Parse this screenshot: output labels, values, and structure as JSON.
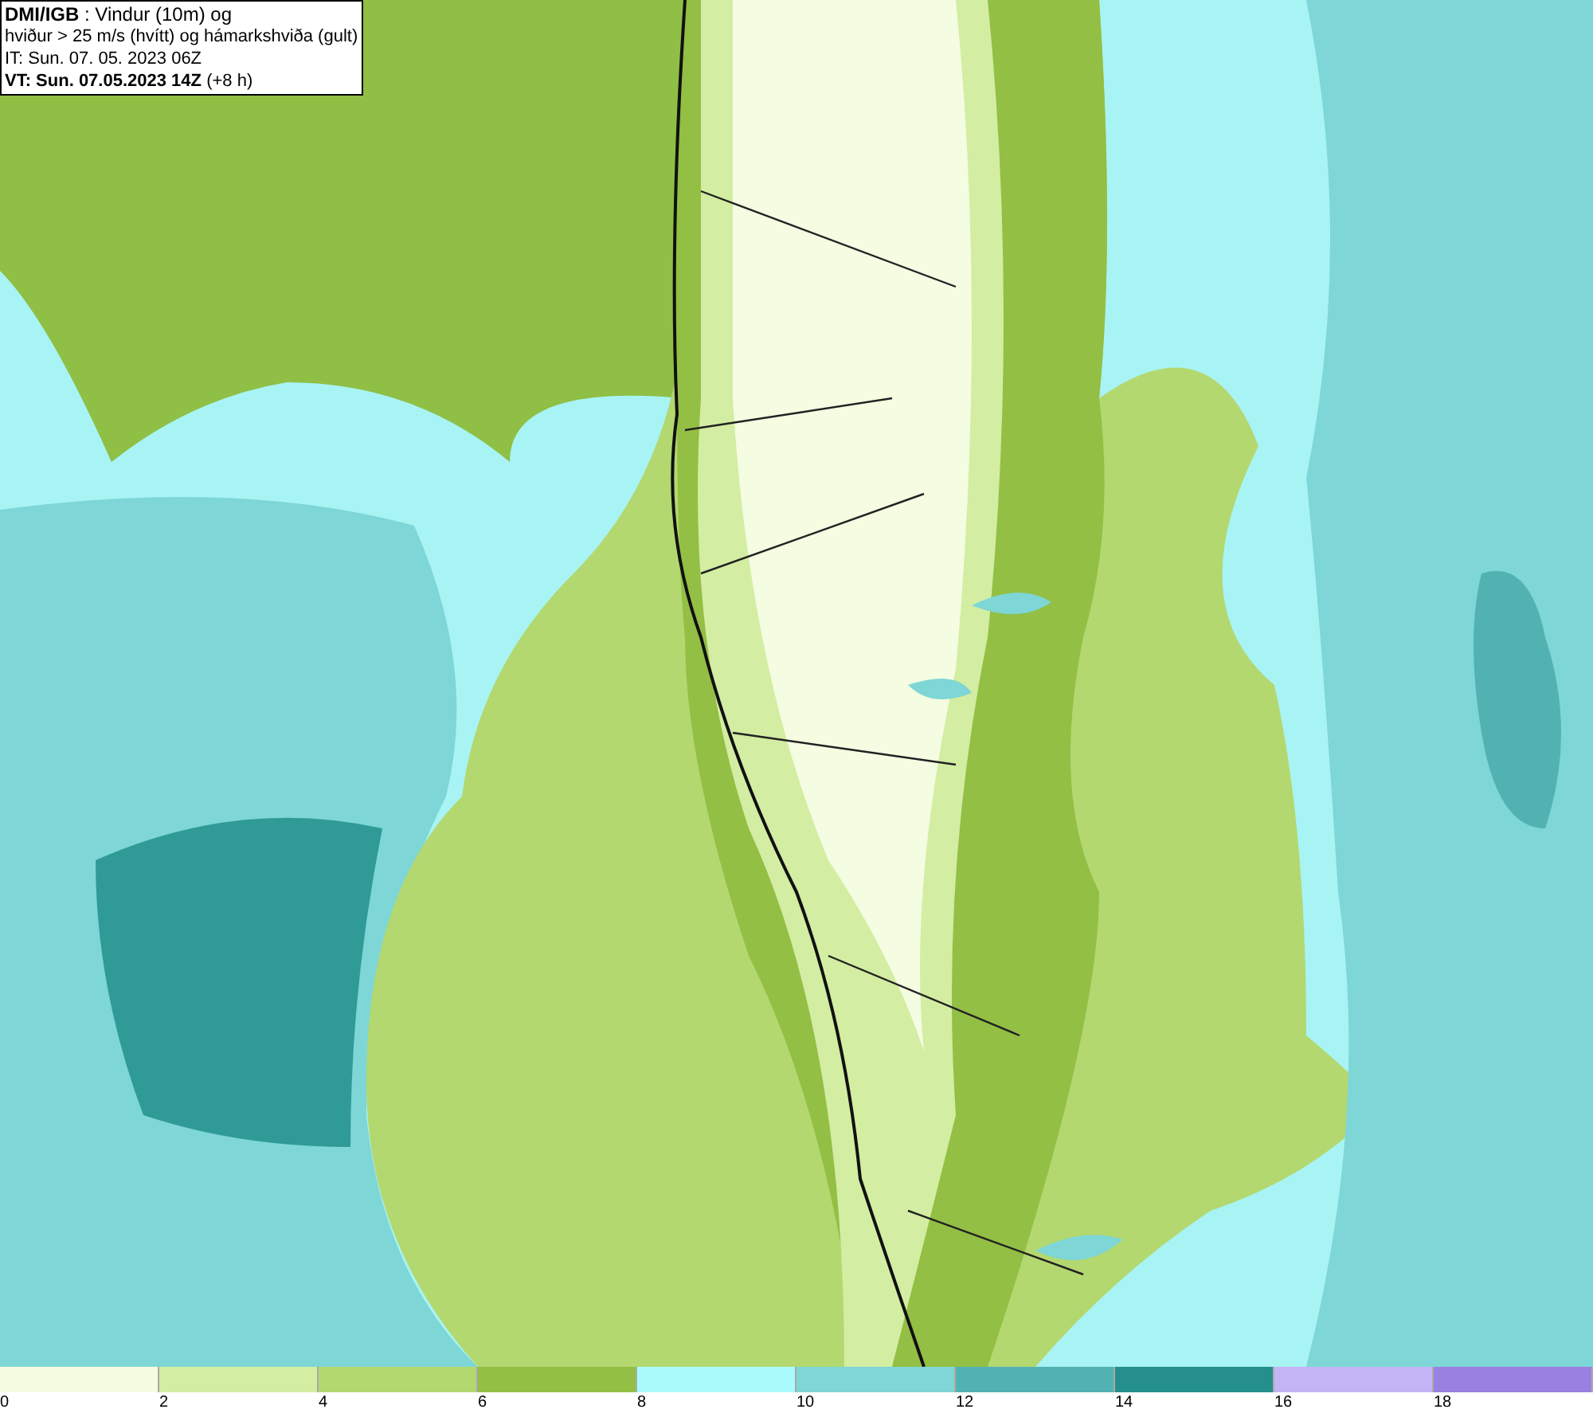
{
  "header": {
    "lines": [
      "**DMI/IGB** : Vindur (10m) og",
      "hviður > 25 m/s (hvítt) og hámarkshviða (gult)",
      "IT: Sun. 07. 05. 2023 06Z",
      "**VT: Sun. 07.05.2023 14Z** (+8 h)"
    ]
  },
  "legend": [
    {
      "label": "0",
      "color": "#f4fce2"
    },
    {
      "label": "2",
      "color": "#d3eda2"
    },
    {
      "label": "4",
      "color": "#b3d870"
    },
    {
      "label": "6",
      "color": "#93bf45"
    },
    {
      "label": "8",
      "color": "#a9fbfb"
    },
    {
      "label": "10",
      "color": "#7ed6d6"
    },
    {
      "label": "12",
      "color": "#52b2b2"
    },
    {
      "label": "14",
      "color": "#248f8c"
    },
    {
      "label": "16",
      "color": "#c4b4f6"
    },
    {
      "label": "18",
      "color": "#9a80e0"
    }
  ]
}
